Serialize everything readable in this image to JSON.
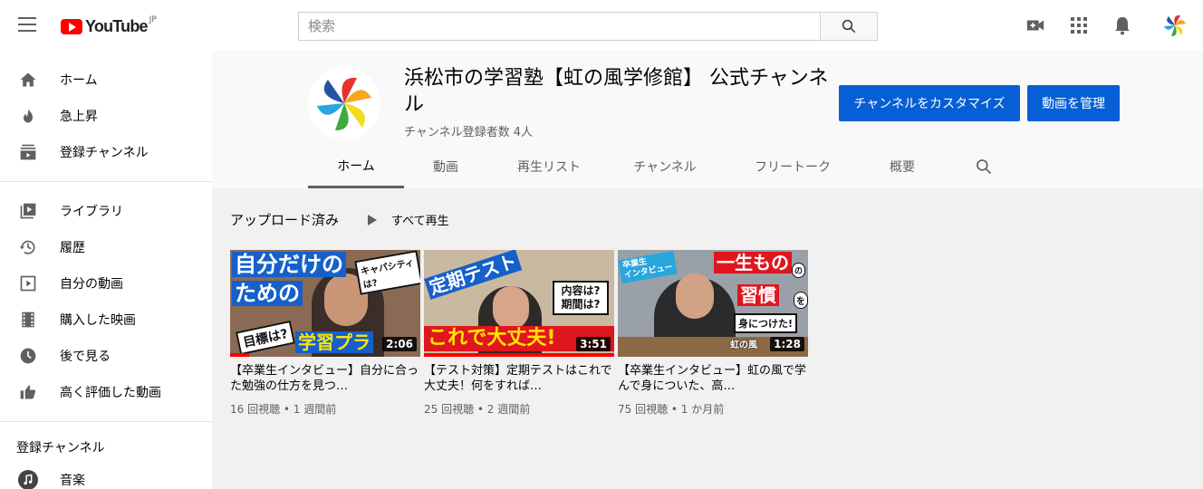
{
  "header": {
    "logo_text": "YouTube",
    "region": "JP",
    "search_placeholder": "検索"
  },
  "sidebar": {
    "items": [
      {
        "label": "ホーム",
        "icon": "home-icon"
      },
      {
        "label": "急上昇",
        "icon": "trending-icon"
      },
      {
        "label": "登録チャンネル",
        "icon": "subscriptions-icon"
      },
      {
        "label": "ライブラリ",
        "icon": "library-icon"
      },
      {
        "label": "履歴",
        "icon": "history-icon"
      },
      {
        "label": "自分の動画",
        "icon": "your-videos-icon"
      },
      {
        "label": "購入した映画",
        "icon": "movies-icon"
      },
      {
        "label": "後で見る",
        "icon": "watch-later-icon"
      },
      {
        "label": "高く評価した動画",
        "icon": "liked-icon"
      }
    ],
    "subscriptions_heading": "登録チャンネル",
    "subscriptions": [
      {
        "label": "音楽",
        "icon": "music-icon"
      }
    ]
  },
  "channel": {
    "title": "浜松市の学習塾【虹の風学修館】 公式チャンネル",
    "subscribers": "チャンネル登録者数 4人",
    "customize_button": "チャンネルをカスタマイズ",
    "manage_button": "動画を管理",
    "tabs": [
      "ホーム",
      "動画",
      "再生リスト",
      "チャンネル",
      "フリートーク",
      "概要"
    ],
    "active_tab": "ホーム"
  },
  "shelf": {
    "title": "アップロード済み",
    "play_all": "すべて再生"
  },
  "videos": [
    {
      "title": "【卒業生インタビュー】自分に合った勉強の仕方を見つ…",
      "meta": "16 回視聴 • 1 週間前",
      "duration": "2:06",
      "progress": 0.1,
      "thumb_text": [
        "自分だけの",
        "ための",
        "目標は?",
        "学習プラ",
        "キャパシティは?"
      ]
    },
    {
      "title": "【テスト対策】定期テストはこれで大丈夫！何をすれば…",
      "meta": "25 回視聴 • 2 週間前",
      "duration": "3:51",
      "progress": 1.0,
      "thumb_text": [
        "定期テスト",
        "内容は?",
        "期間は?",
        "これで大丈夫!"
      ]
    },
    {
      "title": "【卒業生インタビュー】虹の風で学んで身についた、高…",
      "meta": "75 回視聴 • 1 か月前",
      "duration": "1:28",
      "progress": 0.0,
      "thumb_text": [
        "卒業生",
        "インタビュー",
        "一生もの",
        "の",
        "習慣",
        "を",
        "身につけた!",
        "虹の風"
      ]
    }
  ],
  "colors": {
    "brand_red": "#ff0000",
    "button_blue": "#065fd4",
    "thumb_red": "#e0161e",
    "thumb_blue": "#1560c9"
  }
}
